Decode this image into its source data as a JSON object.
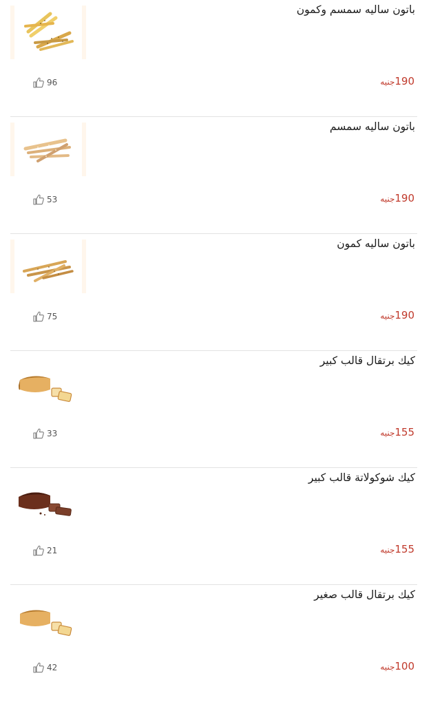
{
  "currency_label": "جنيه",
  "products": [
    {
      "name": "باتون ساليه سمسم وكمون",
      "price": "190",
      "likes": "96",
      "image": "sesame-cumin-breadsticks"
    },
    {
      "name": "باتون ساليه سمسم",
      "price": "190",
      "likes": "53",
      "image": "sesame-breadsticks"
    },
    {
      "name": "باتون ساليه كمون",
      "price": "190",
      "likes": "75",
      "image": "cumin-breadsticks"
    },
    {
      "name": "كيك برتقال قالب كبير",
      "price": "155",
      "likes": "33",
      "image": "orange-loaf-cake"
    },
    {
      "name": "كيك شوكولاتة قالب كبير",
      "price": "155",
      "likes": "21",
      "image": "chocolate-loaf-cake"
    },
    {
      "name": "كيك برتقال قالب صغير",
      "price": "100",
      "likes": "42",
      "image": "orange-loaf-cake"
    }
  ],
  "colors": {
    "price": "#c0392b",
    "divider": "#e2e2e2",
    "text": "#1b1b1b"
  }
}
